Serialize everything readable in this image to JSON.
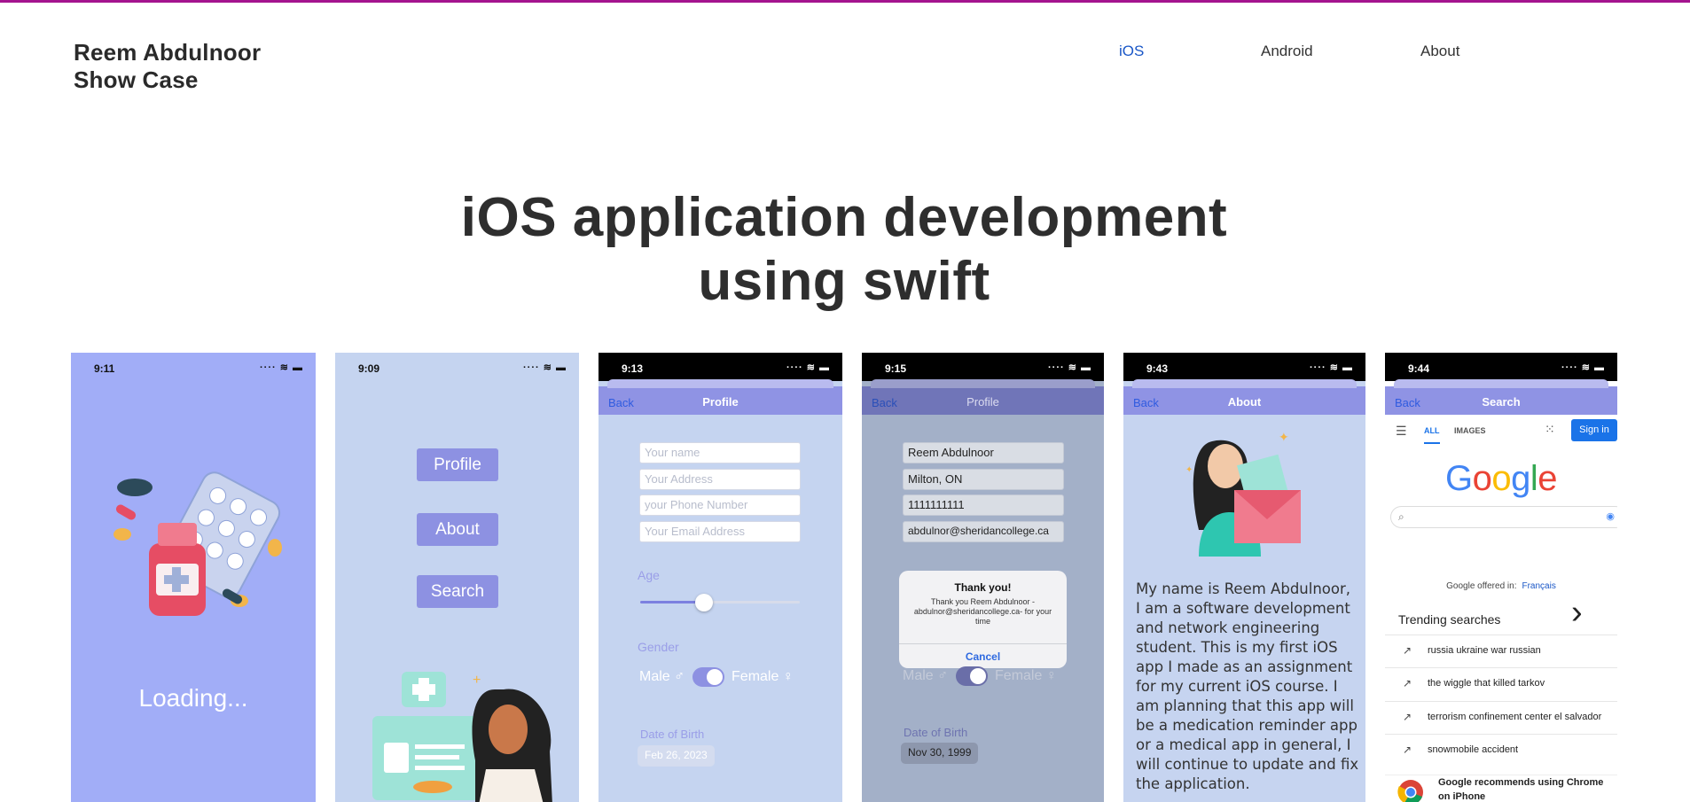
{
  "header": {
    "brand_line1": "Reem Abdulnoor",
    "brand_line2": "Show Case",
    "nav": [
      {
        "label": "iOS",
        "active": true
      },
      {
        "label": "Android",
        "active": false
      },
      {
        "label": "About",
        "active": false
      }
    ],
    "accent_color": "#a4148f",
    "active_nav_color": "#1a57c7"
  },
  "hero": {
    "line1": "iOS application development",
    "line2": "using swift"
  },
  "screens": {
    "loading": {
      "time": "9:11",
      "text": "Loading..."
    },
    "menu": {
      "time": "9:09",
      "buttons": [
        "Profile",
        "About",
        "Search"
      ]
    },
    "profile_empty": {
      "time": "9:13",
      "back": "Back",
      "title": "Profile",
      "placeholders": [
        "Your name",
        "Your Address",
        "your Phone Number",
        "Your Email Address"
      ],
      "age_label": "Age",
      "gender_label": "Gender",
      "male": "Male ♂",
      "female": "Female ♀",
      "dob_label": "Date of Birth",
      "dob_value": "Feb 26, 2023"
    },
    "profile_filled": {
      "time": "9:15",
      "back": "Back",
      "title": "Profile",
      "values": [
        "Reem Abdulnoor",
        "Milton, ON",
        "1111111111",
        "abdulnor@sheridancollege.ca"
      ],
      "alert_title": "Thank you!",
      "alert_message": "Thank you Reem Abdulnoor - abdulnor@sheridancollege.ca- for your time",
      "alert_button": "Cancel",
      "male": "Male ♂",
      "female": "Female ♀",
      "dob_label": "Date of Birth",
      "dob_value": "Nov 30, 1999"
    },
    "about": {
      "time": "9:43",
      "back": "Back",
      "title": "About",
      "text": "My name is Reem Abdulnoor, I am a software development and network engineering student. This is my first iOS app I made as an assignment for my current iOS course. I am planning that this app will be a medication reminder app or a medical app in general, I will continue to update and fix the application."
    },
    "search": {
      "time": "9:44",
      "back": "Back",
      "title": "Search",
      "tab_all": "ALL",
      "tab_images": "IMAGES",
      "sign_in": "Sign in",
      "logo": "Google",
      "offered_in": "Google offered in:",
      "offered_lang": "Français",
      "trending_title": "Trending searches",
      "trending": [
        "russia ukraine war russian",
        "the wiggle that killed tarkov",
        "terrorism confinement center el salvador",
        "snowmobile accident"
      ],
      "chrome_text": "Google recommends using Chrome on iPhone"
    }
  }
}
